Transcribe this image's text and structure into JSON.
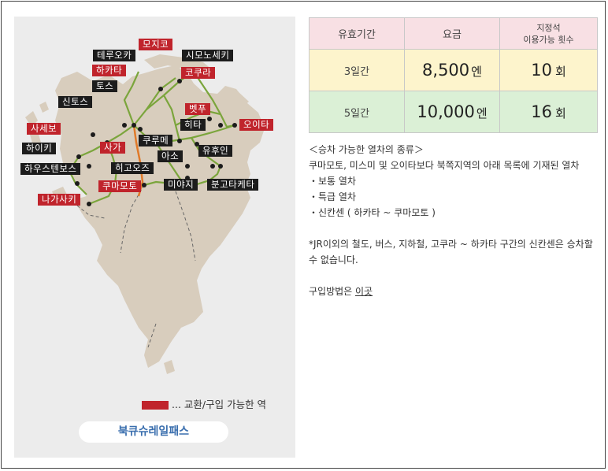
{
  "map": {
    "stations": [
      {
        "name": "모지코",
        "color": "red"
      },
      {
        "name": "테루오카",
        "color": "black"
      },
      {
        "name": "시모노세키",
        "color": "black"
      },
      {
        "name": "하카타",
        "color": "red"
      },
      {
        "name": "코쿠라",
        "color": "red"
      },
      {
        "name": "토스",
        "color": "black"
      },
      {
        "name": "신토스",
        "color": "black"
      },
      {
        "name": "벳푸",
        "color": "red"
      },
      {
        "name": "사세보",
        "color": "red"
      },
      {
        "name": "히타",
        "color": "black"
      },
      {
        "name": "오이타",
        "color": "red"
      },
      {
        "name": "하이키",
        "color": "black"
      },
      {
        "name": "사가",
        "color": "red"
      },
      {
        "name": "쿠루메",
        "color": "black"
      },
      {
        "name": "유후인",
        "color": "black"
      },
      {
        "name": "아소",
        "color": "black"
      },
      {
        "name": "하우스텐보스",
        "color": "black"
      },
      {
        "name": "히고오즈",
        "color": "black"
      },
      {
        "name": "쿠마모토",
        "color": "red"
      },
      {
        "name": "미야지",
        "color": "black"
      },
      {
        "name": "분고타케타",
        "color": "black"
      },
      {
        "name": "나가사키",
        "color": "red"
      }
    ],
    "legend_label": "... 교환/구입 가능한 역",
    "pass_name": "북큐슈레일패스",
    "colors": {
      "red": "#c0242c",
      "black": "#1c1c1c",
      "land": "#d8cdbd",
      "rail": "#7ba53c",
      "shinkansen": "#e07a2a"
    }
  },
  "fare_table": {
    "headers": [
      "유효기간",
      "요금",
      "지정석\n이용가능 횟수"
    ],
    "header_line1": "지정석",
    "header_line2": "이용가능 횟수",
    "rows": [
      {
        "days": "3일간",
        "price": "8,500",
        "price_unit": "엔",
        "count": "10",
        "count_unit": "회"
      },
      {
        "days": "5일간",
        "price": "10,000",
        "price_unit": "엔",
        "count": "16",
        "count_unit": "회"
      }
    ]
  },
  "info": {
    "section_title": "＜승차 가능한 열차의 종류＞",
    "intro": "쿠마모토, 미스미 및 오이타보다 북쪽지역의 아래 목록에 기재된 열차",
    "train_types": [
      "・보통 열차",
      "・특급 열차",
      "・신칸센 ( 하카타 ~ 쿠마모토 )"
    ],
    "note": "*JR이외의 철도, 버스, 지하철, 고쿠라 ~ 하카타 구간의 신칸센은 승차할 수 없습니다.",
    "purchase_label": "구입방법은 ",
    "purchase_link": "이곳"
  }
}
